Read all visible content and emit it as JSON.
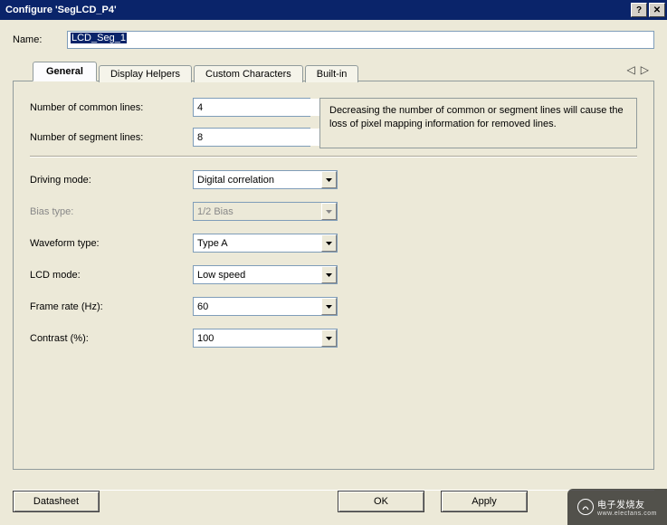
{
  "window": {
    "title": "Configure 'SegLCD_P4'",
    "help_glyph": "?",
    "close_glyph": "✕"
  },
  "name_row": {
    "label": "Name:",
    "value": "LCD_Seg_1"
  },
  "tabs": [
    {
      "label": "General",
      "active": true
    },
    {
      "label": "Display Helpers",
      "active": false
    },
    {
      "label": "Custom Characters",
      "active": false
    },
    {
      "label": "Built-in",
      "active": false
    }
  ],
  "tabnav": {
    "prev_glyph": "◁",
    "next_glyph": "▷"
  },
  "info_text": "Decreasing the number of common or segment lines will cause the loss of pixel mapping information for removed lines.",
  "fields": {
    "common_lines": {
      "label": "Number of common lines:",
      "value": "4"
    },
    "segment_lines": {
      "label": "Number of segment lines:",
      "value": "8"
    },
    "driving_mode": {
      "label": "Driving mode:",
      "value": "Digital correlation"
    },
    "bias_type": {
      "label": "Bias type:",
      "value": "1/2 Bias",
      "disabled": true
    },
    "waveform_type": {
      "label": "Waveform type:",
      "value": "Type A"
    },
    "lcd_mode": {
      "label": "LCD mode:",
      "value": "Low speed"
    },
    "frame_rate": {
      "label": "Frame rate (Hz):",
      "value": "60"
    },
    "contrast": {
      "label": "Contrast (%):",
      "value": "100"
    }
  },
  "buttons": {
    "datasheet": "Datasheet",
    "ok": "OK",
    "apply": "Apply"
  },
  "watermark": {
    "text": "电子发烧友",
    "url": "www.elecfans.com"
  }
}
